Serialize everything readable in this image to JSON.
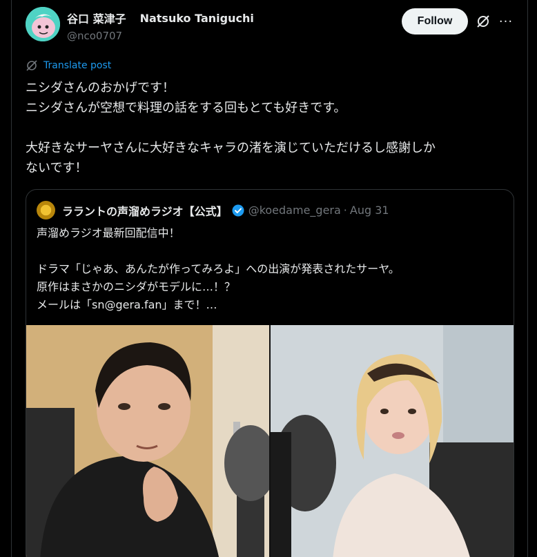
{
  "author": {
    "display_name_ja": "谷口 菜津子",
    "display_name_en": "Natsuko Taniguchi",
    "handle": "@nco0707"
  },
  "actions": {
    "follow_label": "Follow",
    "more_label": "···"
  },
  "translate": {
    "label": "Translate post"
  },
  "post": {
    "text": "ニシダさんのおかげです！\nニシダさんが空想で料理の話をする回もとても好きです。\n\n大好きなサーヤさんに大好きなキャラの渚を演じていただけるし感謝しか\nないです！"
  },
  "quote": {
    "author_name": "ララントの声溜めラジオ【公式】",
    "handle": "@koedame_gera",
    "separator": "·",
    "date": "Aug 31",
    "text": "声溜めラジオ最新回配信中！\n\nドラマ「じゃあ、あんたが作ってみろよ」への出演が発表されたサーヤ。\n原作はまさかのニシダがモデルに…！？\nメールは「sn@gera.fan」まで！…"
  },
  "colors": {
    "background": "#000000",
    "text": "#e7e9ea",
    "muted": "#71767b",
    "accent": "#1d9bf0",
    "border": "#2f3336"
  },
  "icons": {
    "grok": "grok-icon",
    "more": "more-icon",
    "translate": "translate-icon",
    "verified": "verified-badge-icon"
  }
}
